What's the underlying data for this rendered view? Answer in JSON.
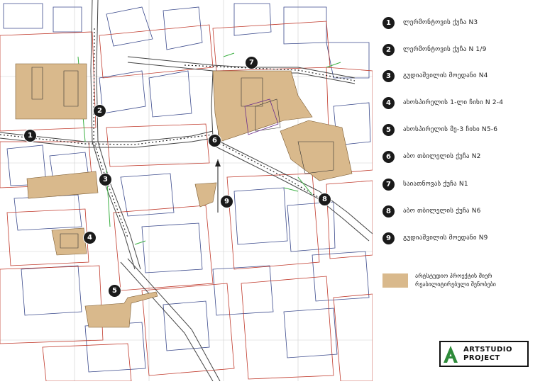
{
  "legend": {
    "items": [
      {
        "num": "1",
        "label": "ლერმონტოვის ქუჩა N3"
      },
      {
        "num": "2",
        "label": "ლერმონტოვის ქუჩა N 1/9"
      },
      {
        "num": "3",
        "label": "გუდიაშვილის მოედანი N4"
      },
      {
        "num": "4",
        "label": "ახოსპირელის 1-ლი ჩიხი N 2-4"
      },
      {
        "num": "5",
        "label": "ახოსპირელის მე-3 ჩიხი N5-6"
      },
      {
        "num": "6",
        "label": "აბო თბილელის ქუჩა N2"
      },
      {
        "num": "7",
        "label": "საიათნოვას ქუჩა N1"
      },
      {
        "num": "8",
        "label": "აბო თბილელის ქუჩა N6"
      },
      {
        "num": "9",
        "label": "გუდიაშვილის მოედანი N9"
      }
    ],
    "swatch_line1": "არტსტუდიო პროექტის მიერ",
    "swatch_line2": "რეაბილიტირებული შენობები",
    "swatch_color": "#d9b98c"
  },
  "logo": {
    "letter": "A",
    "line1": "ARTSTUDIO",
    "line2": "PROJECT",
    "accent": "#2e8b3a"
  },
  "map": {
    "markers": [
      "1",
      "2",
      "3",
      "4",
      "5",
      "6",
      "7",
      "8",
      "9"
    ],
    "colors": {
      "building_red": "#c0392b",
      "building_blue": "#3b4a8c",
      "green": "#3cb043",
      "road": "#444444",
      "rehab": "#d9b98c"
    }
  }
}
